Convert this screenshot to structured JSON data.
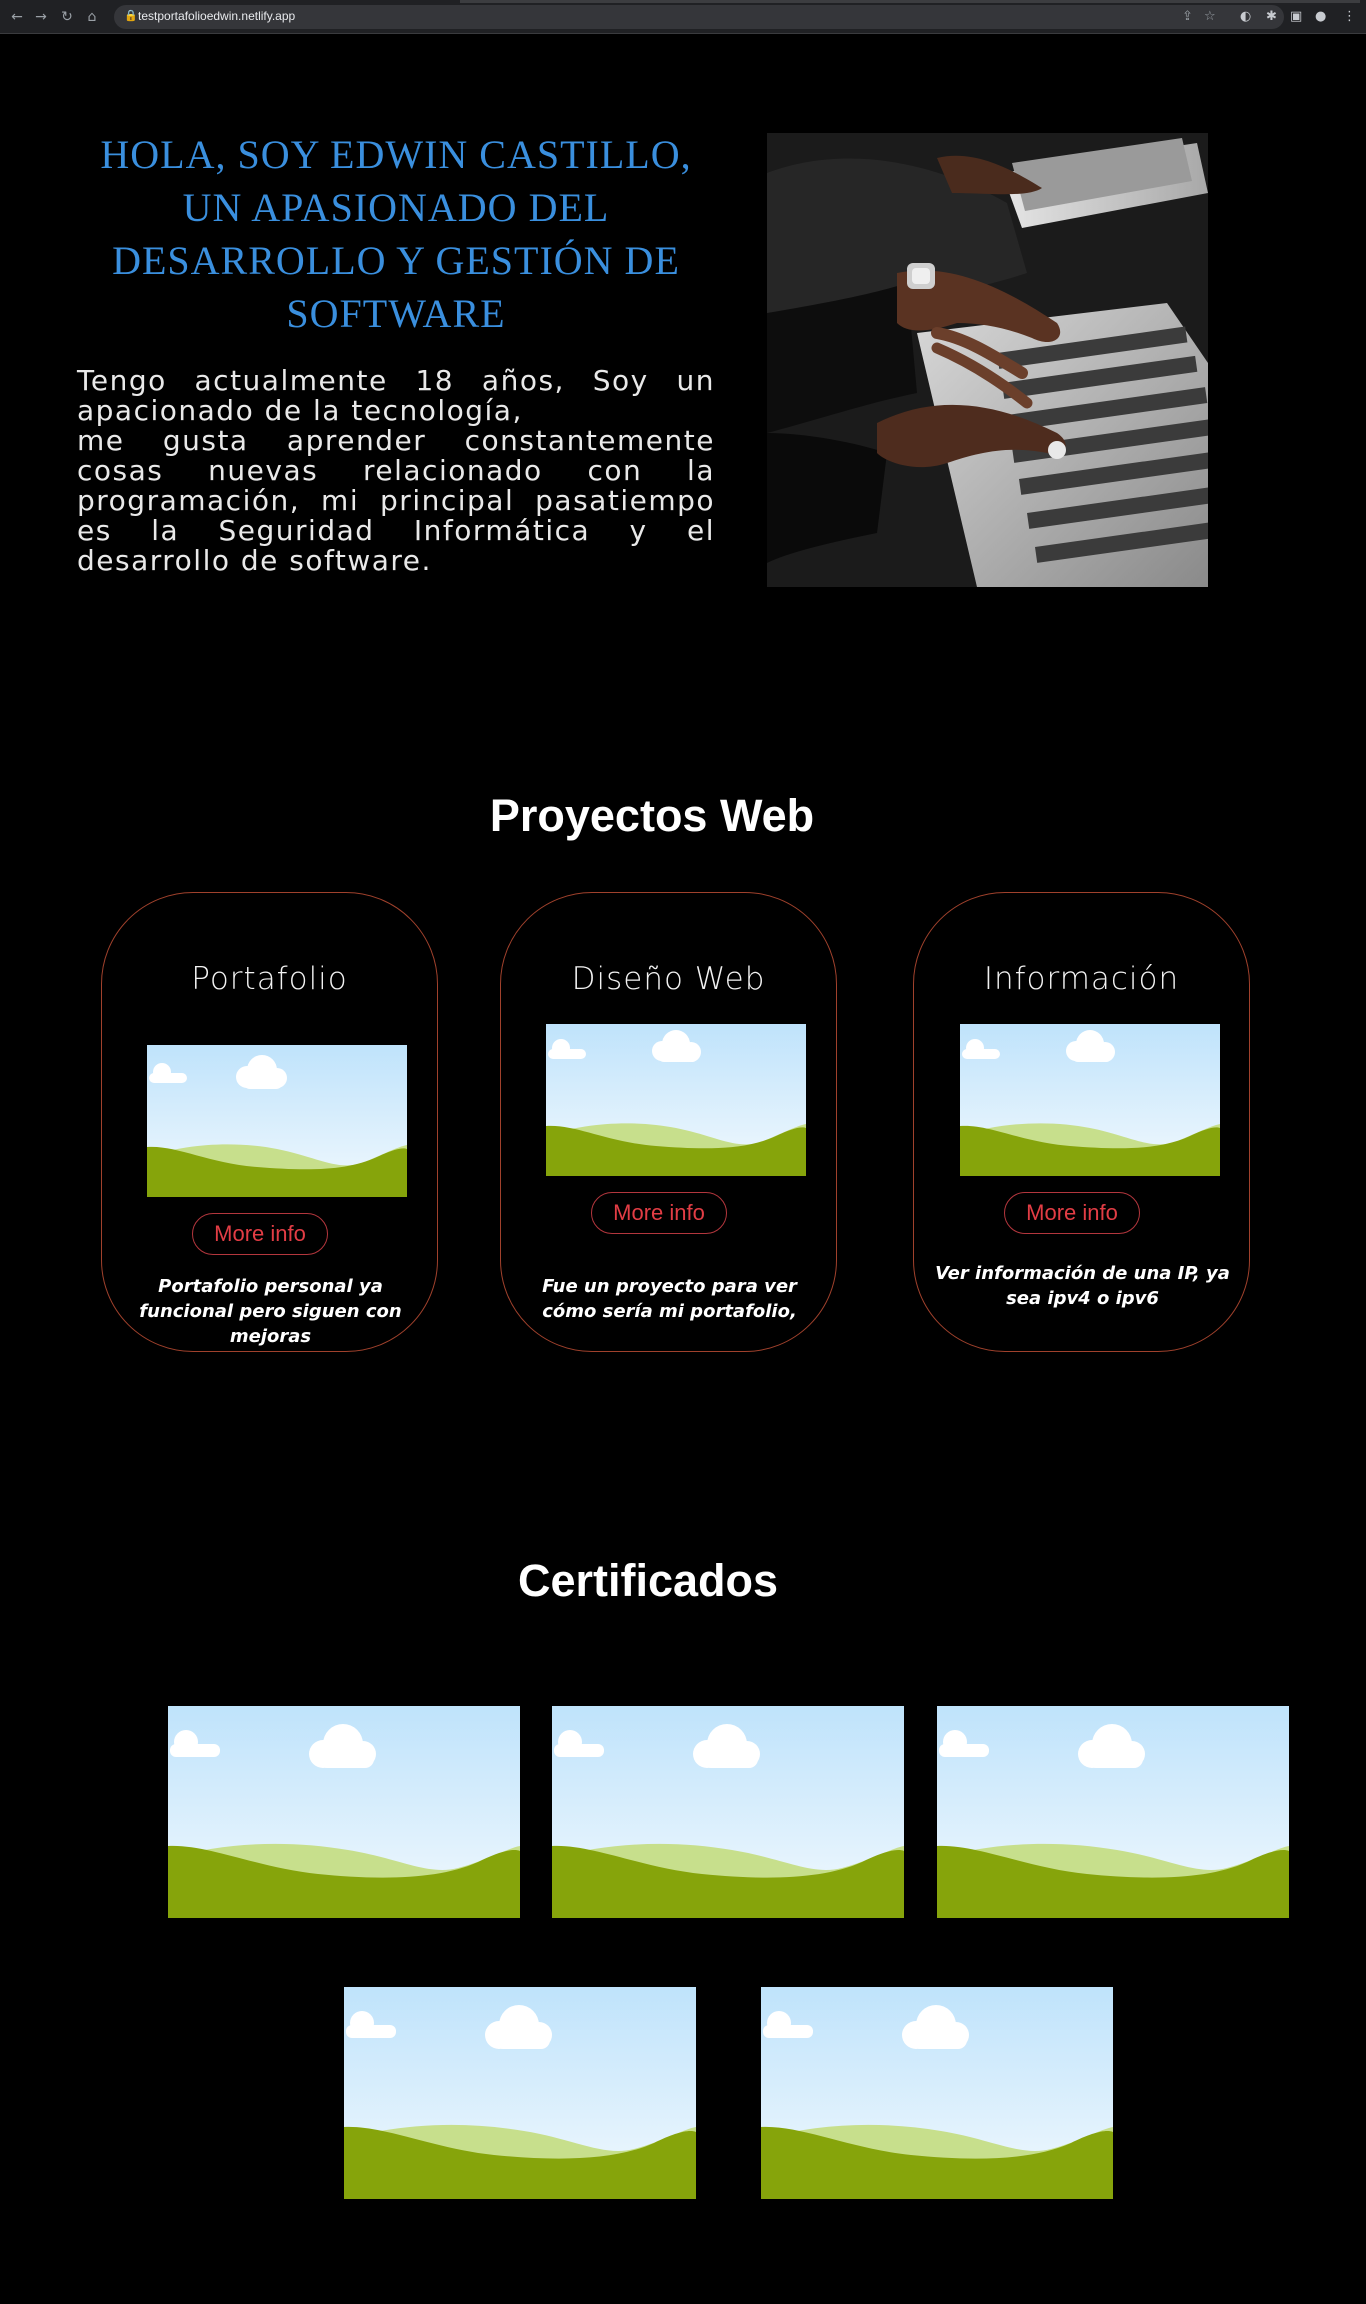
{
  "browser": {
    "url": "testportafolioedwin.netlify.app",
    "nav": {
      "back": "←",
      "forward": "→",
      "reload": "↻",
      "home": "⌂"
    },
    "lock": "🔒",
    "omni_icons": {
      "share": "⇪",
      "bookmark": "☆"
    },
    "extensions": {
      "ext1": "◐",
      "puzzle": "✱",
      "sidepanel": "▣",
      "profile": "●",
      "menu": "⋮"
    }
  },
  "hero": {
    "title": "HOLA, SOY EDWIN CASTILLO, UN APASIONADO DEL DESARROLLO Y GESTIÓN DE SOFTWARE",
    "line1": "Tengo actualmente 18 años, Soy un apacionado de la tecnología,",
    "line2": "me gusta aprender constantemente cosas nuevas relacionado con la programación, mi principal pasatiempo es la Seguridad Informática y el desarrollo de software.",
    "photo_icon": "laptop-typing-photo"
  },
  "projects": {
    "heading": "Proyectos Web",
    "cards": [
      {
        "title": "Portafolio",
        "button": "More info",
        "description": "Portafolio personal ya funcional pero siguen con mejoras"
      },
      {
        "title": "Diseño Web",
        "button": "More info",
        "description": "Fue un proyecto para ver cómo sería mi portafolio,"
      },
      {
        "title": "Información",
        "button": "More info",
        "description": "Ver información de una IP, ya sea ipv4 o ipv6"
      }
    ]
  },
  "certificates": {
    "heading": "Certificados",
    "count": 5
  },
  "colors": {
    "accent_blue": "#3a8fde",
    "card_border": "#a0412c",
    "button_red": "#e23d45",
    "background": "#000000"
  }
}
